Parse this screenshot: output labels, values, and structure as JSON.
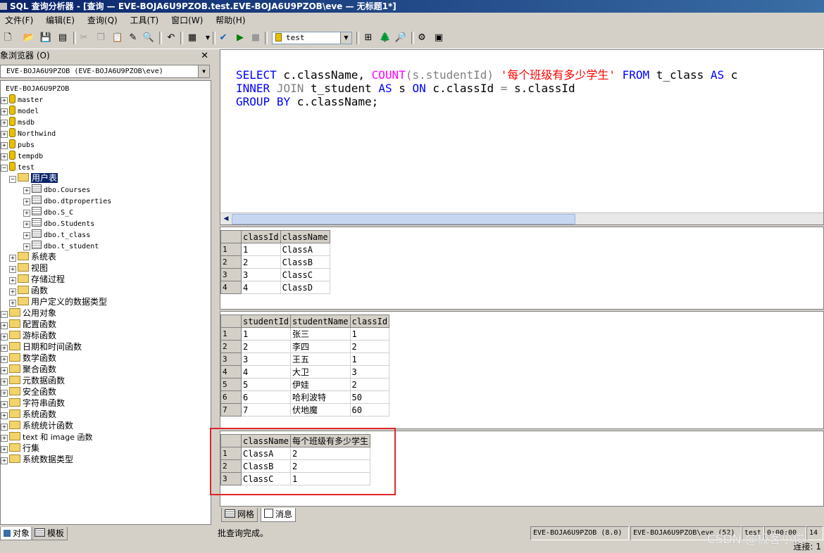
{
  "window": {
    "title": "SQL 查询分析器 - [查询 — EVE-BOJA6U9PZOB.test.EVE-BOJA6U9PZOB\\eve — 无标题1*]"
  },
  "menu": [
    "文件(F)",
    "编辑(E)",
    "查询(Q)",
    "工具(T)",
    "窗口(W)",
    "帮助(H)"
  ],
  "toolbar": {
    "database": "test"
  },
  "object_browser": {
    "title": "象浏览器 (O)",
    "server": "EVE-BOJA6U9PZOB (EVE-BOJA6U9PZOB\\eve)",
    "root": "EVE-BOJA6U9PZOB",
    "databases": [
      "master",
      "model",
      "msdb",
      "Northwind",
      "pubs",
      "tempdb",
      "test"
    ],
    "user_tables_folder": "用户表",
    "tables": [
      "dbo.Courses",
      "dbo.dtproperties",
      "dbo.S_C",
      "dbo.Students",
      "dbo.t_class",
      "dbo.t_student"
    ],
    "test_folders": [
      "系统表",
      "视图",
      "存储过程",
      "函数",
      "用户定义的数据类型"
    ],
    "common_objects": "公用对象",
    "common_folders": [
      "配置函数",
      "游标函数",
      "日期和时间函数",
      "数学函数",
      "聚合函数",
      "元数据函数",
      "安全函数",
      "字符串函数",
      "系统函数",
      "系统统计函数",
      "text 和 image 函数",
      "行集",
      "系统数据类型"
    ],
    "tabs": [
      "对象",
      "模板"
    ]
  },
  "editor": {
    "line1": {
      "kw1": "SELECT",
      "t1": " c.className, ",
      "fn": "COUNT",
      "t2": "(s.studentId) ",
      "str": "'每个班级有多少学生'",
      "t3": " ",
      "kw2": "FROM",
      "t4": " t_class ",
      "kw3": "AS",
      "t5": " c"
    },
    "line2": {
      "kw1": "INNER",
      "t1": " ",
      "kw2": "JOIN",
      "t2": " t_student ",
      "kw3": "AS",
      "t3": " s ",
      "kw4": "ON",
      "t4": " c.classId ",
      "op": "=",
      "t5": " s.classId"
    },
    "line3": {
      "kw1": "GROUP",
      "t1": " ",
      "kw2": "BY",
      "t2": " c.className;"
    }
  },
  "results": [
    {
      "columns": [
        "classId",
        "className"
      ],
      "rows": [
        [
          "1",
          "ClassA"
        ],
        [
          "2",
          "ClassB"
        ],
        [
          "3",
          "ClassC"
        ],
        [
          "4",
          "ClassD"
        ]
      ]
    },
    {
      "columns": [
        "studentId",
        "studentName",
        "classId"
      ],
      "rows": [
        [
          "1",
          "张三",
          "1"
        ],
        [
          "2",
          "李四",
          "2"
        ],
        [
          "3",
          "王五",
          "1"
        ],
        [
          "4",
          "大卫",
          "3"
        ],
        [
          "5",
          "伊娃",
          "2"
        ],
        [
          "6",
          "哈利波特",
          "50"
        ],
        [
          "7",
          "伏地魔",
          "60"
        ]
      ]
    },
    {
      "columns": [
        "className",
        "每个班级有多少学生"
      ],
      "rows": [
        [
          "ClassA",
          "2"
        ],
        [
          "ClassB",
          "2"
        ],
        [
          "ClassC",
          "1"
        ]
      ]
    }
  ],
  "result_tabs": [
    "网格",
    "消息"
  ],
  "status": {
    "message": "批查询完成。",
    "server": "EVE-BOJA6U9PZOB (8.0)",
    "user": "EVE-BOJA6U9PZOB\\eve (52)",
    "db": "test",
    "time": "0:00:00",
    "extra": "14",
    "connections": "连接: 1"
  },
  "watermark": "CSDN @极客小俊",
  "colors": {
    "keyword": "#0000ff",
    "function": "#ff00ff",
    "string": "#ff0000",
    "highlight_box": "#e0262a"
  }
}
